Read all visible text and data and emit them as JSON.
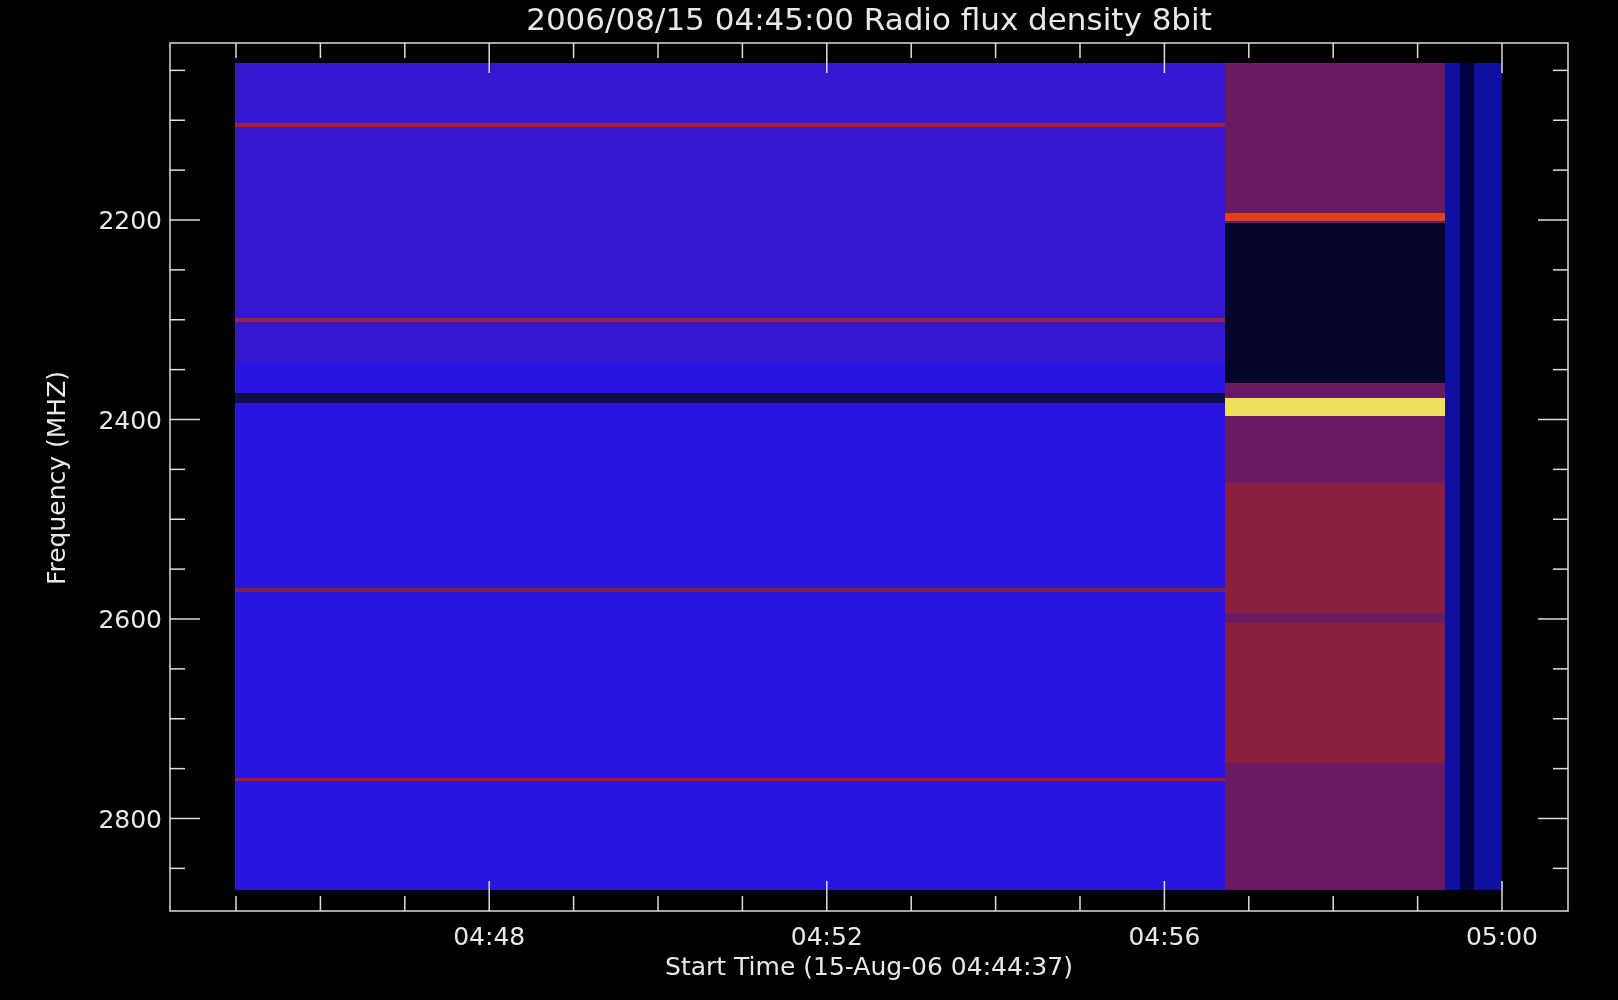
{
  "title": "2006/08/15 04:45:00 Radio flux density 8bit",
  "y_axis": {
    "label": "Frequency (MHZ)",
    "ticks": [
      "2200",
      "2400",
      "2600",
      "2800"
    ]
  },
  "x_axis": {
    "label": "Start Time (15-Aug-06 04:44:37)",
    "ticks": [
      "04:48",
      "04:52",
      "04:56",
      "05:00"
    ]
  }
}
